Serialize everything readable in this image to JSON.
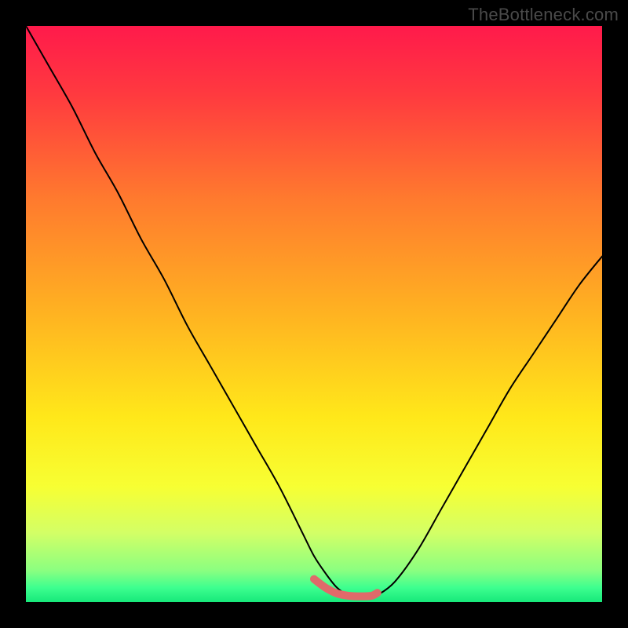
{
  "watermark": "TheBottleneck.com",
  "chart_data": {
    "type": "line",
    "title": "",
    "xlabel": "",
    "ylabel": "",
    "xlim": [
      0,
      100
    ],
    "ylim": [
      0,
      100
    ],
    "grid": false,
    "legend": false,
    "background_gradient_stops": [
      {
        "offset": 0.0,
        "color": "#ff1a4b"
      },
      {
        "offset": 0.12,
        "color": "#ff3a3f"
      },
      {
        "offset": 0.3,
        "color": "#ff7a2e"
      },
      {
        "offset": 0.5,
        "color": "#ffb321"
      },
      {
        "offset": 0.68,
        "color": "#ffe81a"
      },
      {
        "offset": 0.8,
        "color": "#f7ff33"
      },
      {
        "offset": 0.88,
        "color": "#d3ff66"
      },
      {
        "offset": 0.945,
        "color": "#8bff80"
      },
      {
        "offset": 0.975,
        "color": "#3dff8f"
      },
      {
        "offset": 1.0,
        "color": "#17e87a"
      }
    ],
    "series": [
      {
        "name": "bottleneck-curve",
        "color": "#000000",
        "stroke_width": 2,
        "x": [
          0,
          4,
          8,
          12,
          16,
          20,
          24,
          28,
          32,
          36,
          40,
          44,
          48,
          50,
          52,
          54,
          56,
          58,
          60,
          61,
          64,
          68,
          72,
          76,
          80,
          84,
          88,
          92,
          96,
          100
        ],
        "y": [
          100,
          93,
          86,
          78,
          71,
          63,
          56,
          48,
          41,
          34,
          27,
          20,
          12,
          8,
          5,
          2.5,
          1.2,
          1.0,
          1.0,
          1.2,
          3.5,
          9,
          16,
          23,
          30,
          37,
          43,
          49,
          55,
          60
        ]
      },
      {
        "name": "optimal-range-highlight",
        "color": "#e06a6a",
        "stroke_width": 10,
        "x": [
          50,
          52,
          54,
          56,
          58,
          60,
          61
        ],
        "y": [
          4.0,
          2.5,
          1.5,
          1.1,
          1.0,
          1.1,
          1.6
        ]
      }
    ]
  }
}
